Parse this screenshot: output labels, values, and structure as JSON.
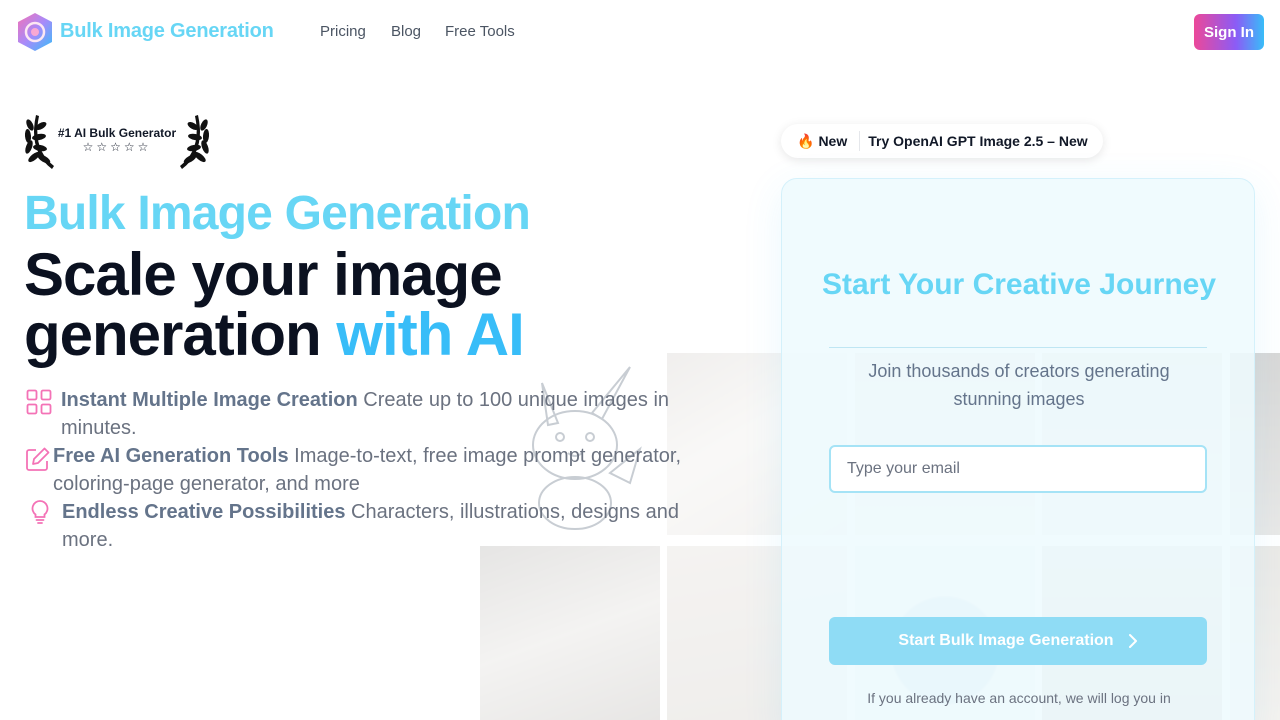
{
  "header": {
    "brand": "Bulk Image Generation",
    "logo_icon": "gradient-gem-logo-icon",
    "nav": [
      "Pricing",
      "Blog",
      "Free Tools"
    ],
    "signin_label": "Sign In"
  },
  "hero": {
    "award_text": "#1 AI Bulk Generator",
    "award_stars": "☆☆☆☆☆",
    "kicker": "Bulk Image Generation",
    "headline_line1": "Scale your image",
    "headline_line2_plain": "generation ",
    "headline_line2_accent": "with AI",
    "features": [
      {
        "icon": "grid-icon",
        "title": "Instant Multiple Image Creation",
        "text": " Create up to 100 unique images in minutes."
      },
      {
        "icon": "edit-icon",
        "title": "Free AI Generation Tools",
        "text": " Image-to-text, free image prompt generator, coloring-page generator, and more"
      },
      {
        "icon": "lightbulb-icon",
        "title": "Endless Creative Possibilities",
        "text": " Characters, illustrations, designs and more."
      }
    ]
  },
  "badge": {
    "emoji": "🔥",
    "tag": "New",
    "message": "Try OpenAI GPT Image 2.5 – New"
  },
  "signup": {
    "title": "Start Your Creative Journey",
    "subtitle": "Join thousands of creators generating stunning images",
    "email_placeholder": "Type your email",
    "cta_label": "Start Bulk Image Generation",
    "note": "If you already have an account, we will log you in"
  },
  "colors": {
    "brand_cyan": "#67d6f5",
    "accent_blue": "#38bdf8",
    "signin_gradient_start": "#ec4899",
    "icon_pink": "#f472b6"
  }
}
